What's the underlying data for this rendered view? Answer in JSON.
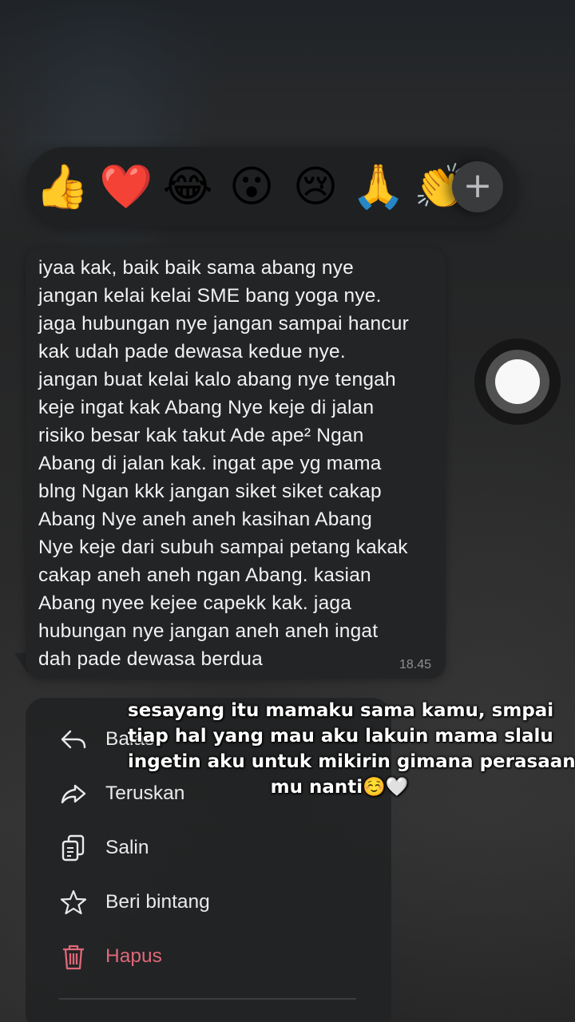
{
  "reactions": {
    "emojis": [
      "👍",
      "❤️",
      "😂",
      "😮",
      "😢",
      "🙏",
      "👏"
    ],
    "plus_label": "+"
  },
  "message": {
    "lines": [
      "iyaa kak, baik baik sama abang nye",
      "jangan kelai kelai SME bang yoga nye.",
      "jaga hubungan nye jangan sampai hancur",
      "kak udah pade dewasa kedue nye.",
      "jangan buat kelai kalo abang nye tengah",
      "keje ingat kak Abang Nye keje di jalan",
      "risiko besar kak takut Ade ape² Ngan",
      "Abang di jalan kak. ingat ape yg mama",
      "blng Ngan kkk jangan siket siket cakap",
      "Abang Nye aneh aneh kasihan Abang",
      "Nye keje dari subuh sampai petang kakak",
      "cakap aneh aneh ngan Abang. kasian",
      "Abang nyee kejee capekk kak. jaga",
      "hubungan nye jangan aneh aneh ingat",
      "dah pade dewasa berdua"
    ],
    "time": "18.45"
  },
  "menu": {
    "items": [
      {
        "label": "Balas",
        "icon": "reply-icon"
      },
      {
        "label": "Teruskan",
        "icon": "forward-icon"
      },
      {
        "label": "Salin",
        "icon": "copy-icon"
      },
      {
        "label": "Beri bintang",
        "icon": "star-icon"
      },
      {
        "label": "Hapus",
        "icon": "trash-icon"
      }
    ],
    "danger_color": "#e0677a"
  },
  "caption": {
    "lines": [
      "sesayang itu mamaku sama kamu, smpai",
      "tiap hal yang mau aku lakuin mama slalu",
      "ingetin aku untuk mikirin gimana perasaan",
      "mu nanti☺️🤍"
    ]
  }
}
